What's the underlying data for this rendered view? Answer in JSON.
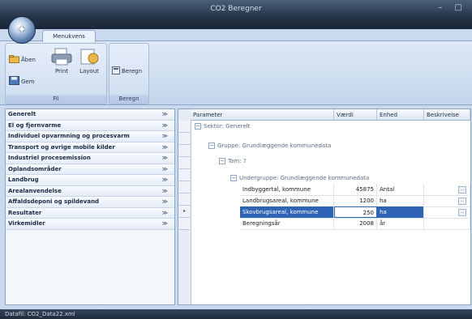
{
  "window": {
    "title": "CO2 Beregner",
    "controls": [
      "–",
      "□"
    ]
  },
  "ribbon": {
    "tab_label": "Menukvens",
    "groups": {
      "fil": {
        "label": "Fil",
        "aabn_label": "Åben",
        "gem_label": "Gem",
        "print_label": "Print",
        "layout_label": "Layout"
      },
      "beregn": {
        "label": "Beregn",
        "beregn_label": "Beregn"
      }
    }
  },
  "nav": {
    "items": [
      {
        "label": "Generelt"
      },
      {
        "label": "El og fjernvarme"
      },
      {
        "label": "Individuel opvarmning og procesvarm"
      },
      {
        "label": "Transport og øvrige mobile kilder"
      },
      {
        "label": "Industriel procesemission"
      },
      {
        "label": "Oplandsområder"
      },
      {
        "label": "Landbrug"
      },
      {
        "label": "Arealanvendelse"
      },
      {
        "label": "Affaldsdeponi og spildevand"
      },
      {
        "label": "Resultater"
      },
      {
        "label": "Virkemidler"
      }
    ],
    "chevron": "≫"
  },
  "grid": {
    "columns": [
      "Parameter",
      "Værdi",
      "Enhed",
      "Beskrivelse"
    ],
    "tree": {
      "sektor": "Sektor: Generelt",
      "gruppe": "Gruppe: Grundlæggende kommunedata",
      "tom": "Tom: ?",
      "undergruppe": "Undergruppe: Grundlæggende kommunedata"
    },
    "rows": [
      {
        "parameter": "Indbyggertal, kommune",
        "value": "45875",
        "unit": "Antal"
      },
      {
        "parameter": "Landbrugsareal, kommune",
        "value": "1200",
        "unit": "ha"
      },
      {
        "parameter": "Skovbrugsareal, kommune",
        "value": "250",
        "unit": "ha"
      },
      {
        "parameter": "Beregningsår",
        "value": "2008",
        "unit": "år"
      }
    ],
    "selected_row": 2
  },
  "status": {
    "text": "Datafil: CO2_Data22.xml"
  }
}
